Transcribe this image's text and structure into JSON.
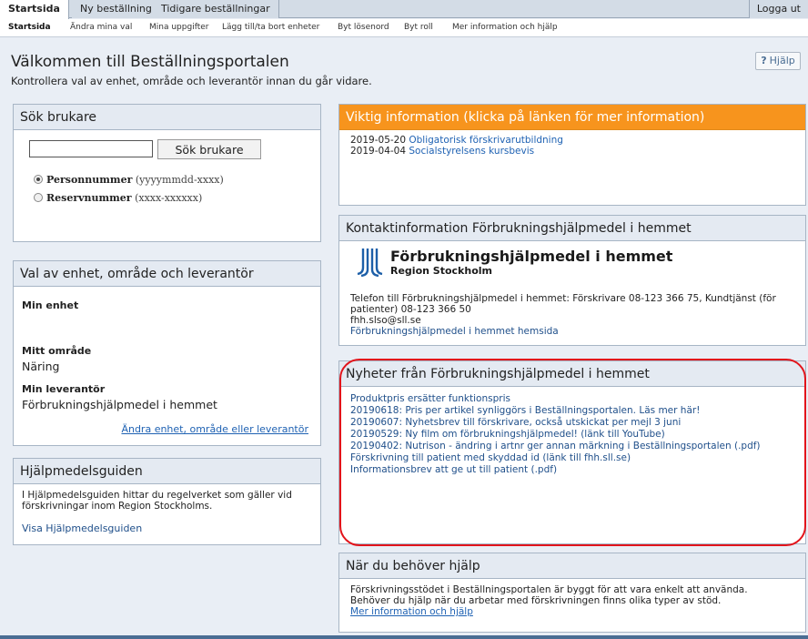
{
  "topbar": {
    "tabs": [
      {
        "label": "Startsida",
        "active": true
      },
      {
        "label": "Ny beställning",
        "active": false
      },
      {
        "label": "Tidigare beställningar",
        "active": false
      }
    ],
    "logout_label": "Logga ut"
  },
  "submenu": {
    "items": [
      {
        "label": "Startsida",
        "active": true
      },
      {
        "label": "Ändra mina val"
      },
      {
        "label": "Mina uppgifter"
      },
      {
        "label": "Lägg till/ta bort enheter"
      },
      {
        "label": "Byt lösenord"
      },
      {
        "label": "Byt roll"
      },
      {
        "label": "Mer information och hjälp"
      }
    ]
  },
  "header": {
    "title": "Välkommen till Beställningsportalen",
    "subtitle": "Kontrollera val av enhet, område och leverantör innan du går vidare.",
    "help_icon": "?",
    "help_label": "Hjälp"
  },
  "search": {
    "title": "Sök brukare",
    "input_value": "",
    "button_label": "Sök brukare",
    "options": [
      {
        "label": "Personnummer",
        "hint": "(yyyymmdd-xxxx)",
        "checked": true
      },
      {
        "label": "Reservnummer",
        "hint": "(xxxx-xxxxxx)",
        "checked": false
      }
    ]
  },
  "selection": {
    "title": "Val av enhet, område och leverantör",
    "unit_label": "Min enhet",
    "unit_value": "",
    "area_label": "Mitt område",
    "area_value": "Näring",
    "supplier_label": "Min leverantör",
    "supplier_value": "Förbrukningshjälpmedel i hemmet",
    "change_link": "Ändra enhet, område eller leverantör"
  },
  "guide": {
    "title": "Hjälpmedelsguiden",
    "text_line1": "I Hjälpmedelsguiden hittar du regelverket som gäller vid",
    "text_line2": "förskrivningar inom Region Stockholms.",
    "link": "Visa Hjälpmedelsguiden"
  },
  "important": {
    "title": "Viktig information (klicka på länken för mer information)",
    "items": [
      {
        "date": "2019-05-20",
        "text": "Obligatorisk förskrivarutbildning"
      },
      {
        "date": "2019-04-04",
        "text": "Socialstyrelsens kursbevis"
      }
    ]
  },
  "contact": {
    "title": "Kontaktinformation Förbrukningshjälpmedel i hemmet",
    "logo_name": "Förbrukningshjälpmedel i hemmet",
    "logo_region": "Region Stockholm",
    "phone_line1": "Telefon till Förbrukningshjälpmedel i hemmet: Förskrivare 08-123 366 75, Kundtjänst (för",
    "phone_line2": "patienter) 08-123 366 50",
    "email": "fhh.slso@sll.se",
    "homepage_link": "Förbrukningshjälpmedel i hemmet hemsida"
  },
  "news": {
    "title": "Nyheter från Förbrukningshjälpmedel i hemmet",
    "items": [
      "Produktpris ersätter funktionspris",
      "20190618: Pris per artikel synliggörs i Beställningsportalen. Läs mer här!",
      "20190607: Nyhetsbrev till förskrivare, också utskickat per mejl 3 juni",
      "20190529: Ny film om förbrukningshjälpmedel! (länk till YouTube)",
      "20190402: Nutrison - ändring i artnr ger annan märkning i Beställningsportalen (.pdf)",
      "Förskrivning till patient med skyddad id (länk till fhh.sll.se)",
      "Informationsbrev att ge ut till patient (.pdf)"
    ]
  },
  "help": {
    "title": "När du behöver hjälp",
    "line1": "Förskrivningsstödet i Beställningsportalen är byggt för att vara enkelt att använda.",
    "line2": "Behöver du hjälp när du arbetar med förskrivningen finns olika typer av stöd.",
    "link": "Mer information och hjälp"
  },
  "colors": {
    "accent": "#f7941d",
    "link": "#1f62b3",
    "highlight_ring": "#e2141b",
    "logo_blue": "#1d5fa8"
  }
}
